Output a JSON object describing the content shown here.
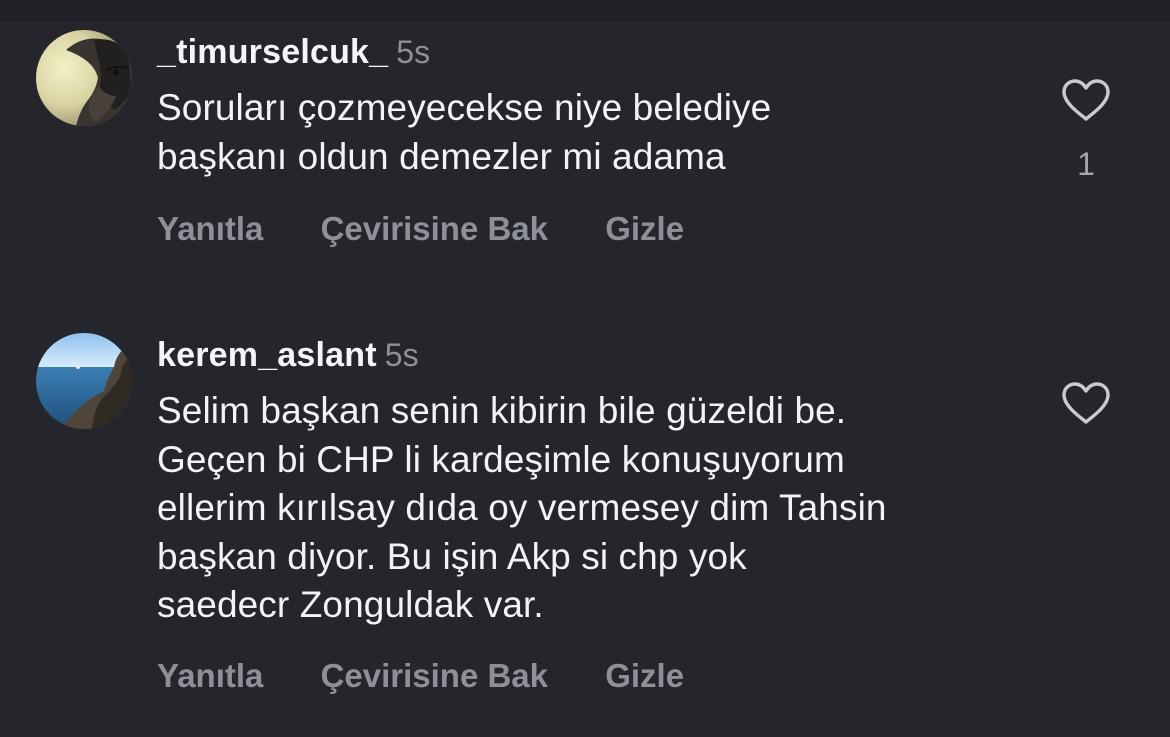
{
  "colors": {
    "background": "#24262b",
    "primary_text": "#f2f3f5",
    "secondary_text": "#8d9098"
  },
  "comments": [
    {
      "username": "_timurselcuk_",
      "time": "5s",
      "text_lines": [
        "Soruları çozmeyecekse niye belediye",
        "başkanı oldun demezler mi adama"
      ],
      "like_count": "1",
      "avatar_icon": "bearded-man-avatar",
      "actions": {
        "reply": "Yanıtla",
        "translate": "Çevirisine Bak",
        "hide": "Gizle"
      }
    },
    {
      "username": "kerem_aslant",
      "time": "5s",
      "text_lines": [
        "Selim başkan senin kibirin bile güzeldi be.",
        "Geçen bi CHP li kardeşimle konuşuyorum",
        "ellerim kırılsay dıda oy vermesey dim Tahsin",
        "başkan diyor. Bu işin Akp si chp yok",
        "saedecr Zonguldak var."
      ],
      "like_count": "",
      "avatar_icon": "seaside-rock-avatar",
      "actions": {
        "reply": "Yanıtla",
        "translate": "Çevirisine Bak",
        "hide": "Gizle"
      }
    }
  ]
}
